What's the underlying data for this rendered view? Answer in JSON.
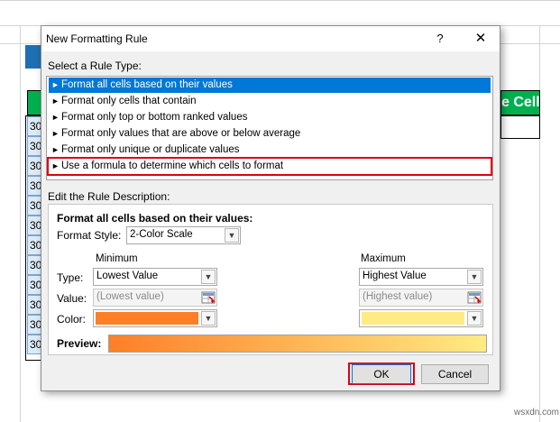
{
  "background": {
    "header_cell_text": "e Cell",
    "row_numbers": [
      "30",
      "30",
      "30",
      "30",
      "30",
      "30",
      "30",
      "30",
      "30",
      "30",
      "30",
      "30"
    ]
  },
  "dialog": {
    "title": "New Formatting Rule",
    "help": "?",
    "close": "✕",
    "select_rule_type_label": "Select a Rule Type:",
    "rule_types": [
      "Format all cells based on their values",
      "Format only cells that contain",
      "Format only top or bottom ranked values",
      "Format only values that are above or below average",
      "Format only unique or duplicate values",
      "Use a formula to determine which cells to format"
    ],
    "selected_rule_index": 0,
    "edit_description_label": "Edit the Rule Description:",
    "description_heading": "Format all cells based on their values:",
    "format_style_label": "Format Style:",
    "format_style_value": "2-Color Scale",
    "minimum": {
      "heading": "Minimum",
      "type_value": "Lowest Value",
      "value_placeholder": "(Lowest value)",
      "color": "#ff7f27"
    },
    "maximum": {
      "heading": "Maximum",
      "type_value": "Highest Value",
      "value_placeholder": "(Highest value)",
      "color": "#ffeb84"
    },
    "type_label": "Type:",
    "value_label": "Value:",
    "color_label": "Color:",
    "preview_label": "Preview:",
    "ok_label": "OK",
    "cancel_label": "Cancel"
  },
  "watermark": "wsxdn.com",
  "colors": {
    "selection": "#0078d7",
    "highlight_border": "#e0000f",
    "excel_green": "#00b050",
    "header_blue": "#1f6fb2"
  }
}
